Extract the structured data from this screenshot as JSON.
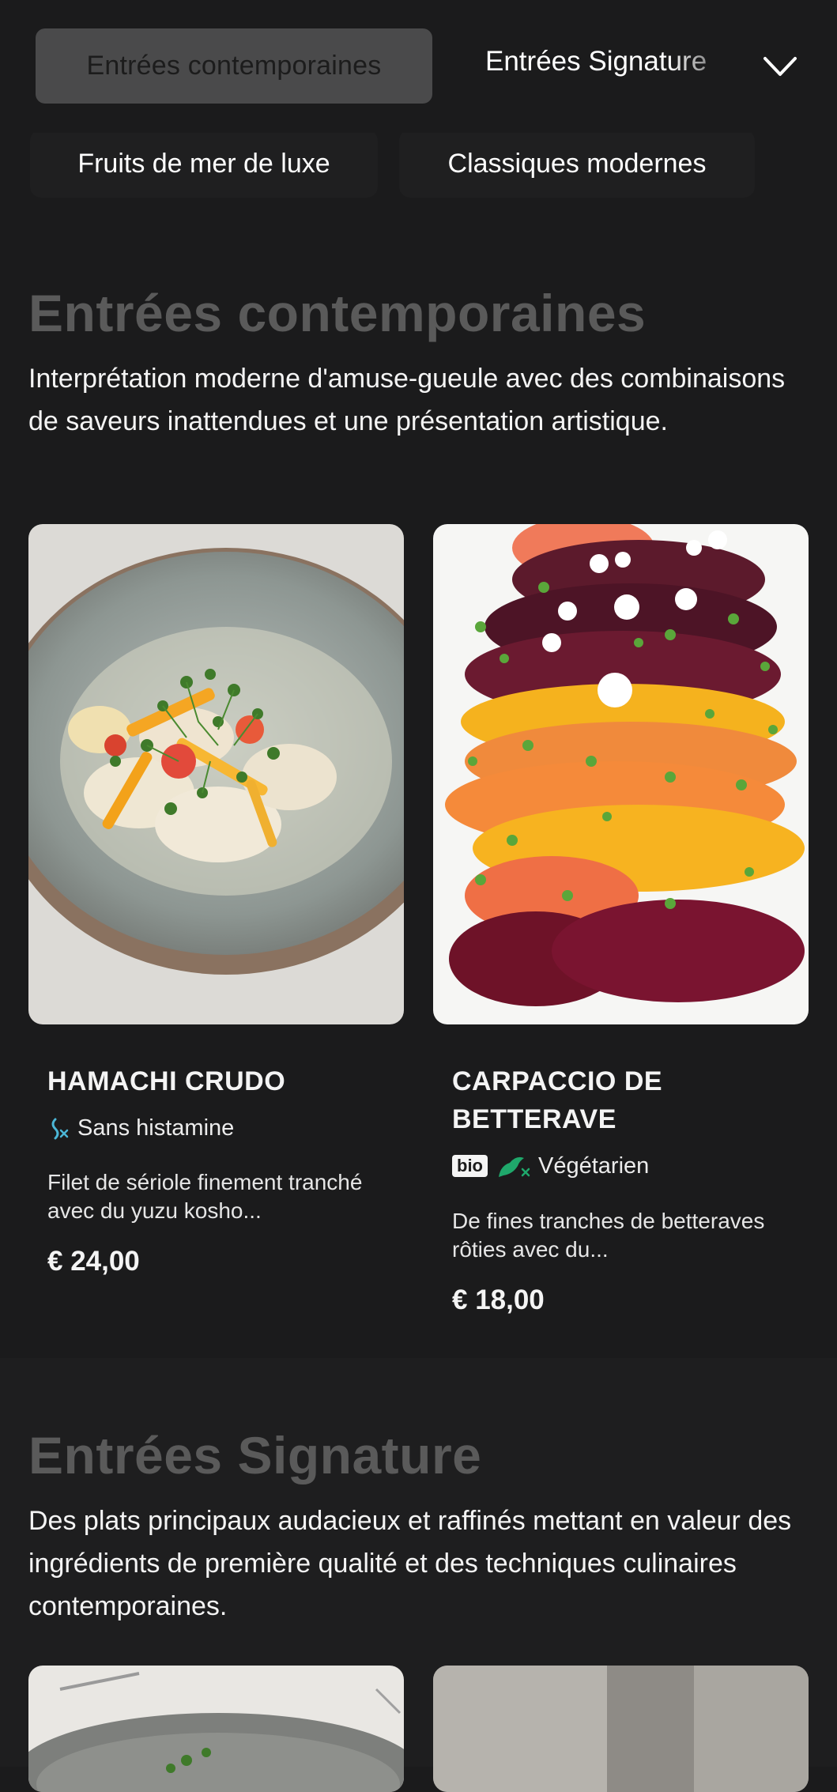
{
  "nav": {
    "active_category": "Entrées contemporaines",
    "next_category": "Entrées Signature",
    "chips": [
      "Fruits de mer de luxe",
      "Classiques modernes"
    ]
  },
  "sections": [
    {
      "title": "Entrées contemporaines",
      "description": "Interprétation moderne d'amuse-gueule avec des combinaisons de saveurs inattendues et une présentation artistique.",
      "dishes": [
        {
          "name": "HAMACHI CRUDO",
          "tags": [
            "Sans histamine"
          ],
          "description": "Filet de sériole finement tranché avec du yuzu kosho...",
          "price": "€ 24,00"
        },
        {
          "name": "CARPACCIO DE BETTERAVE",
          "bio_label": "bio",
          "tags": [
            "Végétarien"
          ],
          "description": "De fines tranches de betteraves rôties avec du...",
          "price": "€ 18,00"
        }
      ]
    },
    {
      "title": "Entrées Signature",
      "description": "Des plats principaux audacieux et raffinés mettant en valeur des ingrédients de première qualité et des techniques culinaires contemporaines."
    }
  ]
}
